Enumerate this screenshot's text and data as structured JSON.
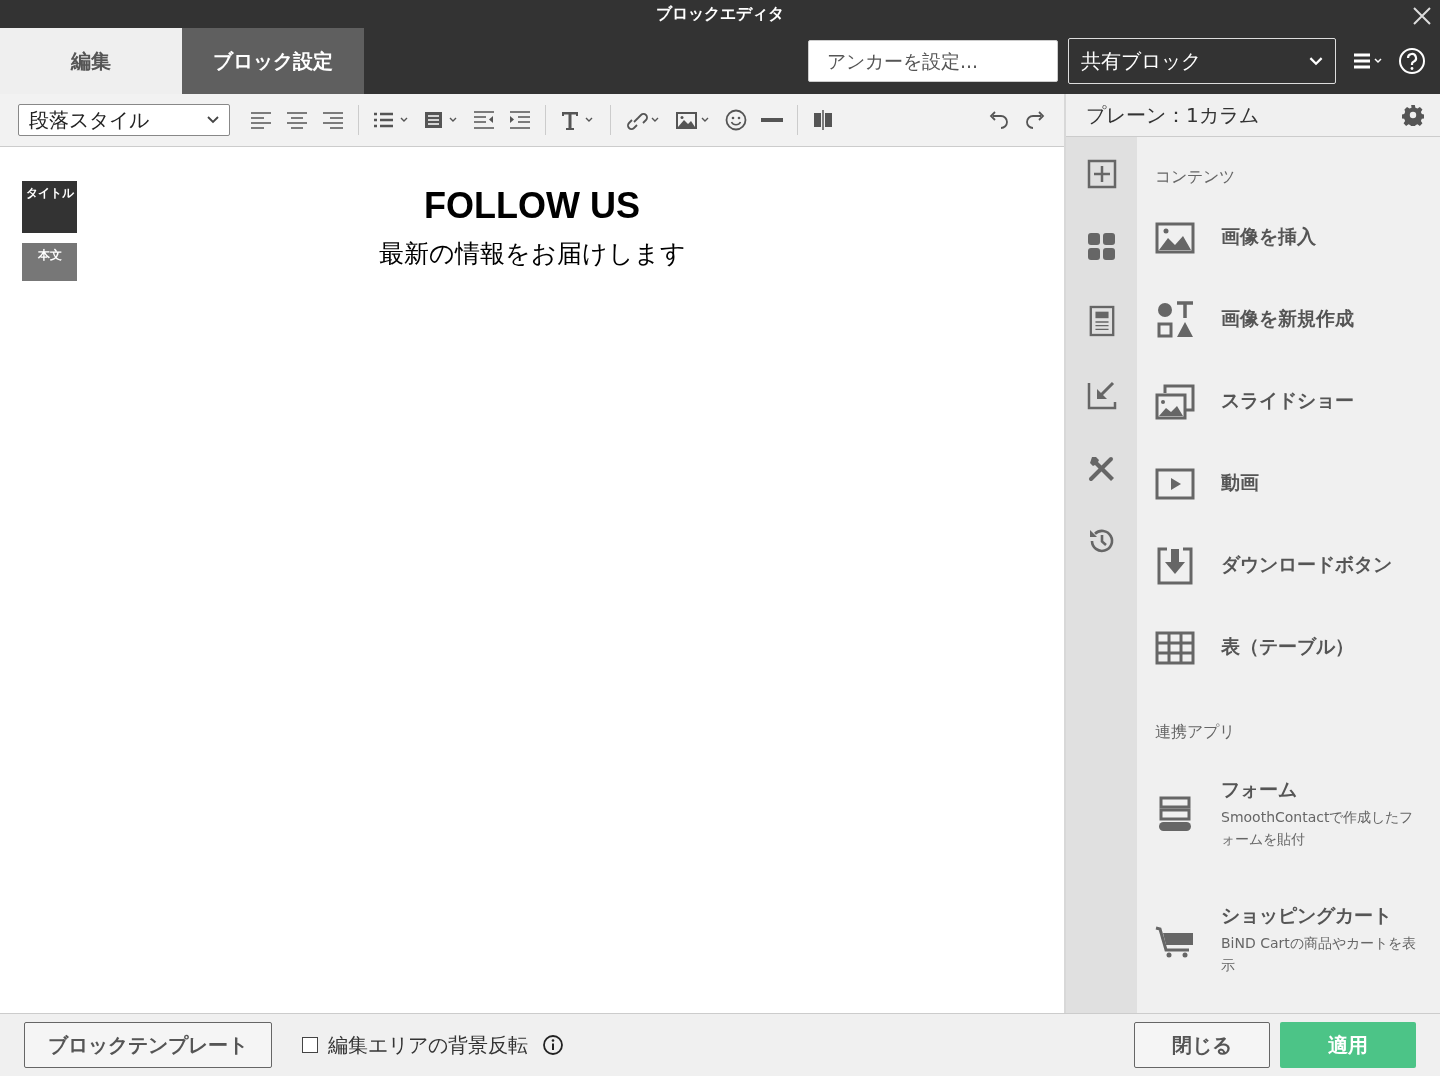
{
  "window": {
    "title": "ブロックエディタ"
  },
  "tabs": [
    {
      "label": "編集",
      "selected": true
    },
    {
      "label": "ブロック設定",
      "selected": false
    }
  ],
  "anchor_field": {
    "placeholder": "アンカーを設定..."
  },
  "shared_block_select": {
    "value": "共有ブロック"
  },
  "paragraph_style_select": {
    "value": "段落スタイル"
  },
  "layout_panel": {
    "title": "プレーン：1カラム"
  },
  "style_markers": [
    {
      "label": "タイトル",
      "kind": "title"
    },
    {
      "label": "本文",
      "kind": "body"
    }
  ],
  "content": {
    "heading": "FOLLOW US",
    "body": "最新の情報をお届けします"
  },
  "sections": [
    {
      "heading": "コンテンツ",
      "items": [
        {
          "label": "画像を挿入",
          "kind": "image"
        },
        {
          "label": "画像を新規作成",
          "kind": "shapes"
        },
        {
          "label": "スライドショー",
          "kind": "slides"
        },
        {
          "label": "動画",
          "kind": "video"
        },
        {
          "label": "ダウンロードボタン",
          "kind": "download"
        },
        {
          "label": "表（テーブル）",
          "kind": "table"
        }
      ]
    },
    {
      "heading": "連携アプリ",
      "items": [
        {
          "label": "フォーム",
          "description": "SmoothContactで作成したフォームを貼付",
          "kind": "form"
        },
        {
          "label": "ショッピングカート",
          "description": "BiND Cartの商品やカートを表示",
          "kind": "cart"
        }
      ]
    }
  ],
  "footer": {
    "template_button": "ブロックテンプレート",
    "background_toggle": {
      "label": "編集エリアの背景反転",
      "checked": false
    },
    "close_button": "閉じる",
    "apply_button": "適用"
  }
}
